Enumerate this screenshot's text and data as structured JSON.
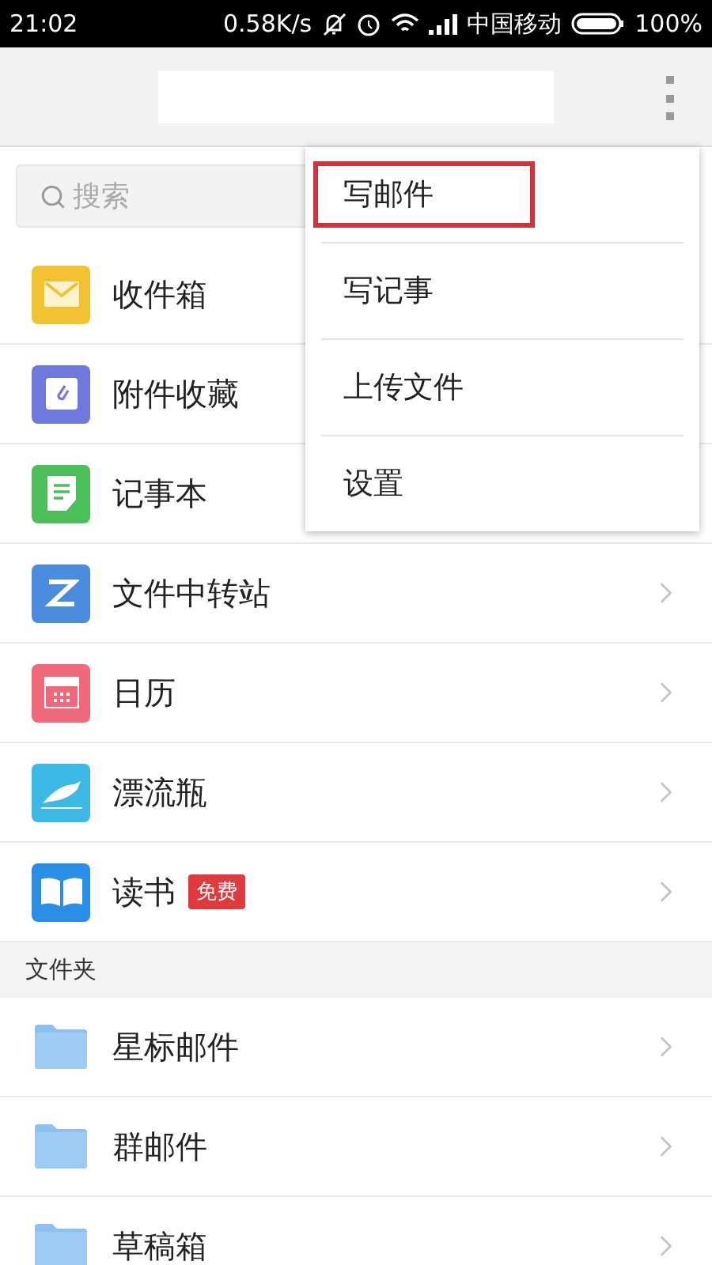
{
  "status_bar": {
    "time": "21:02",
    "speed": "0.58K/s",
    "carrier": "中国移动",
    "battery": "100%"
  },
  "search": {
    "placeholder": "搜索"
  },
  "apps": [
    {
      "label": "收件箱",
      "kind": "mail",
      "color": "#f1c232",
      "arrow": false
    },
    {
      "label": "附件收藏",
      "kind": "attachment",
      "color": "#6f79dd",
      "arrow": false
    },
    {
      "label": "记事本",
      "kind": "note",
      "color": "#4dbf5a",
      "arrow": false
    },
    {
      "label": "文件中转站",
      "kind": "transfer",
      "color": "#4a8bdc",
      "arrow": true
    },
    {
      "label": "日历",
      "kind": "calendar",
      "color": "#f0697a",
      "arrow": true
    },
    {
      "label": "漂流瓶",
      "kind": "bird",
      "color": "#3bb8e3",
      "arrow": true
    },
    {
      "label": "读书",
      "kind": "book",
      "color": "#2a8ee6",
      "arrow": true,
      "badge": "免费"
    }
  ],
  "folder_section": {
    "title": "文件夹"
  },
  "folders": [
    {
      "label": "星标邮件"
    },
    {
      "label": "群邮件"
    },
    {
      "label": "草稿箱"
    }
  ],
  "menu": [
    {
      "label": "写邮件",
      "outlined": true
    },
    {
      "label": "写记事",
      "outlined": false
    },
    {
      "label": "上传文件",
      "outlined": false
    },
    {
      "label": "设置",
      "outlined": false
    }
  ]
}
